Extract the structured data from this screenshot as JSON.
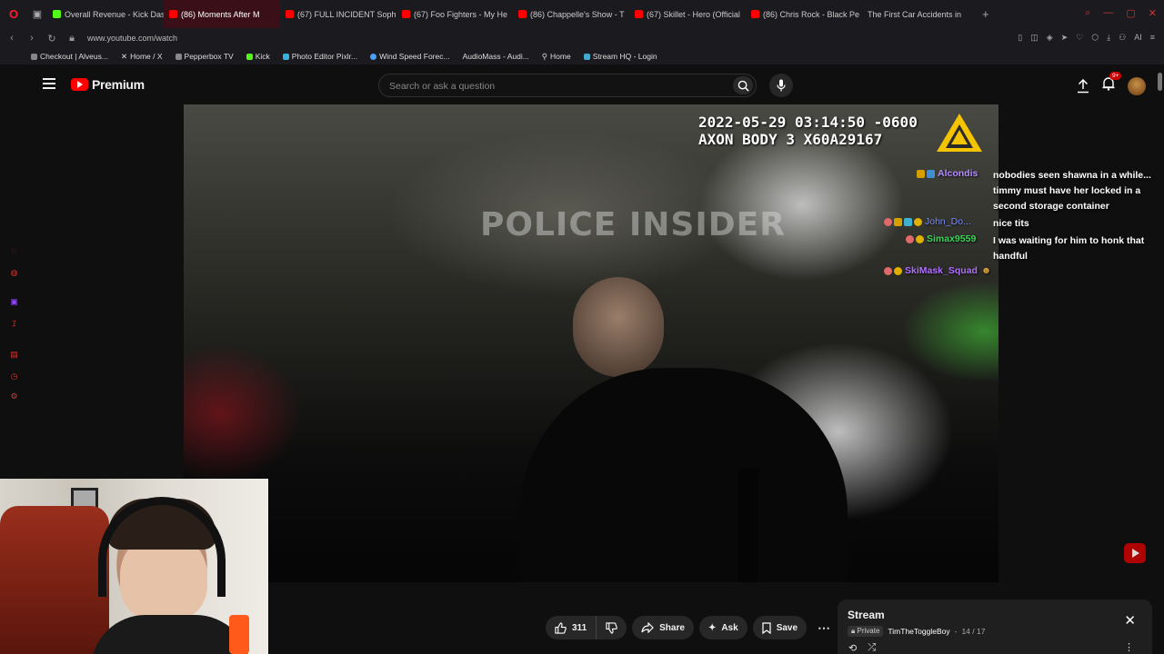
{
  "browser": {
    "tabs": [
      {
        "label": "Overall Revenue - Kick Das",
        "favicon": "kick"
      },
      {
        "label": "(86) Moments After M",
        "favicon": "yt",
        "active": true
      },
      {
        "label": "(67) FULL INCIDENT Soph",
        "favicon": "yt"
      },
      {
        "label": "(67) Foo Fighters - My He",
        "favicon": "yt"
      },
      {
        "label": "(86) Chappelle's Show - T",
        "favicon": "yt"
      },
      {
        "label": "(67) Skillet - Hero (Official",
        "favicon": "yt"
      },
      {
        "label": "(86) Chris Rock - Black Pe",
        "favicon": "yt"
      },
      {
        "label": "The First Car Accidents in",
        "favicon": "none"
      }
    ],
    "new_tab": "+",
    "url": "www.youtube.com/watch",
    "bookmarks": [
      {
        "label": "Checkout | Alveus..."
      },
      {
        "label": "Home / X"
      },
      {
        "label": "Pepperbox TV"
      },
      {
        "label": "Kick"
      },
      {
        "label": "Photo Editor Pixlr..."
      },
      {
        "label": "Wind Speed Forec..."
      },
      {
        "label": "AudioMass - Audi..."
      },
      {
        "label": "Home"
      },
      {
        "label": "Stream HQ - Login"
      }
    ],
    "ai_label": "AI"
  },
  "youtube": {
    "logo_text": "Premium",
    "search_placeholder": "Search or ask a question",
    "notification_count": "9+"
  },
  "video": {
    "timestamp_line1": "2022-05-29 03:14:50 -0600",
    "timestamp_line2": "AXON BODY 3 X60A29167",
    "watermark": "POLICE INSIDER"
  },
  "chat": [
    {
      "user": "Alcondis",
      "color": "#b48cff",
      "message": "nobodies seen shawna in a while... timmy must have her locked in a second storage container"
    },
    {
      "user": "John_Do...",
      "color": "#7a8cff",
      "message": "nice tits"
    },
    {
      "user": "Simax9559",
      "color": "#3fd15a",
      "message": "I was waiting for him to honk that handful"
    },
    {
      "user": "SkiMask_Squad",
      "color": "#b070ff",
      "message": ""
    }
  ],
  "actions": {
    "like_count": "311",
    "share_label": "Share",
    "ask_label": "Ask",
    "save_label": "Save"
  },
  "playlist": {
    "title": "Stream",
    "privacy": "Private",
    "owner": "TimTheToggleBoy",
    "position": "14 / 17"
  },
  "colors": {
    "accent_red": "#ff0000",
    "opera_red": "#ff1b2d"
  }
}
